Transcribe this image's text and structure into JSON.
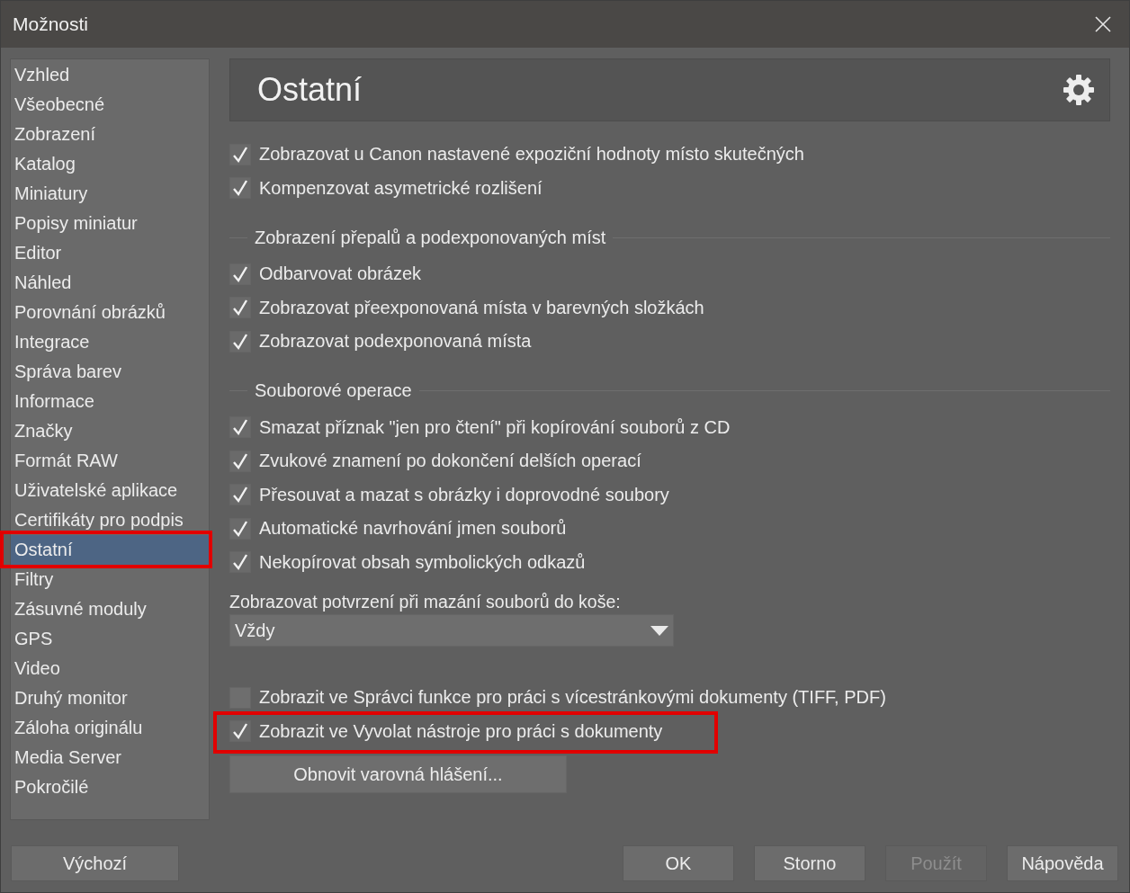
{
  "window": {
    "title": "Možnosti"
  },
  "sidebar": {
    "items": [
      {
        "label": "Vzhled",
        "selected": false,
        "highlighted": false
      },
      {
        "label": "Všeobecné",
        "selected": false,
        "highlighted": false
      },
      {
        "label": "Zobrazení",
        "selected": false,
        "highlighted": false
      },
      {
        "label": "Katalog",
        "selected": false,
        "highlighted": false
      },
      {
        "label": "Miniatury",
        "selected": false,
        "highlighted": false
      },
      {
        "label": "Popisy miniatur",
        "selected": false,
        "highlighted": false
      },
      {
        "label": "Editor",
        "selected": false,
        "highlighted": false
      },
      {
        "label": "Náhled",
        "selected": false,
        "highlighted": false
      },
      {
        "label": "Porovnání obrázků",
        "selected": false,
        "highlighted": false
      },
      {
        "label": "Integrace",
        "selected": false,
        "highlighted": false
      },
      {
        "label": "Správa barev",
        "selected": false,
        "highlighted": false
      },
      {
        "label": "Informace",
        "selected": false,
        "highlighted": false
      },
      {
        "label": "Značky",
        "selected": false,
        "highlighted": false
      },
      {
        "label": "Formát RAW",
        "selected": false,
        "highlighted": false
      },
      {
        "label": "Uživatelské aplikace",
        "selected": false,
        "highlighted": false
      },
      {
        "label": "Certifikáty pro podpis",
        "selected": false,
        "highlighted": false
      },
      {
        "label": "Ostatní",
        "selected": true,
        "highlighted": true
      },
      {
        "label": "Filtry",
        "selected": false,
        "highlighted": false
      },
      {
        "label": "Zásuvné moduly",
        "selected": false,
        "highlighted": false
      },
      {
        "label": "GPS",
        "selected": false,
        "highlighted": false
      },
      {
        "label": "Video",
        "selected": false,
        "highlighted": false
      },
      {
        "label": "Druhý monitor",
        "selected": false,
        "highlighted": false
      },
      {
        "label": "Záloha originálu",
        "selected": false,
        "highlighted": false
      },
      {
        "label": "Media Server",
        "selected": false,
        "highlighted": false
      },
      {
        "label": "Pokročilé",
        "selected": false,
        "highlighted": false
      }
    ]
  },
  "panel": {
    "title": "Ostatní",
    "items": [
      {
        "kind": "checkbox",
        "label": "Zobrazovat u Canon nastavené expoziční hodnoty místo skutečných",
        "checked": true,
        "highlighted": false
      },
      {
        "kind": "checkbox",
        "label": "Kompenzovat asymetrické rozlišení",
        "checked": true,
        "highlighted": false
      },
      {
        "kind": "group",
        "label": "Zobrazení přepalů a podexponovaných míst"
      },
      {
        "kind": "checkbox",
        "label": "Odbarvovat obrázek",
        "checked": true,
        "highlighted": false
      },
      {
        "kind": "checkbox",
        "label": "Zobrazovat přeexponovaná místa v barevných složkách",
        "checked": true,
        "highlighted": false
      },
      {
        "kind": "checkbox",
        "label": "Zobrazovat podexponovaná místa",
        "checked": true,
        "highlighted": false
      },
      {
        "kind": "group",
        "label": "Souborové operace"
      },
      {
        "kind": "checkbox",
        "label": "Smazat příznak \"jen pro čtení\" při kopírování souborů z CD",
        "checked": true,
        "highlighted": false
      },
      {
        "kind": "checkbox",
        "label": "Zvukové znamení po dokončení delších operací",
        "checked": true,
        "highlighted": false
      },
      {
        "kind": "checkbox",
        "label": "Přesouvat a mazat s obrázky i doprovodné soubory",
        "checked": true,
        "highlighted": false
      },
      {
        "kind": "checkbox",
        "label": "Automatické navrhování jmen souborů",
        "checked": true,
        "highlighted": false
      },
      {
        "kind": "checkbox",
        "label": "Nekopírovat obsah symbolických odkazů",
        "checked": true,
        "highlighted": false
      },
      {
        "kind": "select",
        "label": "Zobrazovat potvrzení při mazání souborů do koše:",
        "value": "Vždy"
      },
      {
        "kind": "checkbox",
        "label": "Zobrazit ve Správci funkce pro práci s vícestránkovými dokumenty (TIFF, PDF)",
        "checked": false,
        "highlighted": false
      },
      {
        "kind": "checkbox",
        "label": "Zobrazit ve Vyvolat nástroje pro práci s dokumenty",
        "checked": true,
        "highlighted": true
      },
      {
        "kind": "button",
        "label": "Obnovit varovná hlášení..."
      }
    ]
  },
  "footer": {
    "left": {
      "label": "Výchozí",
      "disabled": false
    },
    "buttons": [
      {
        "label": "OK",
        "disabled": false
      },
      {
        "label": "Storno",
        "disabled": false
      },
      {
        "label": "Použít",
        "disabled": true
      },
      {
        "label": "Nápověda",
        "disabled": false
      }
    ]
  }
}
